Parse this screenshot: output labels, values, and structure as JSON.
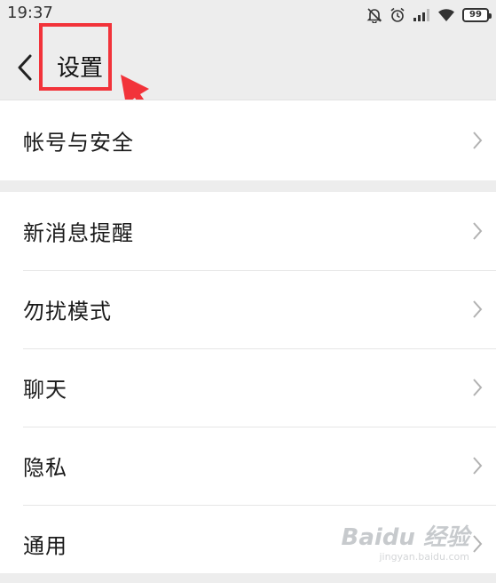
{
  "status_bar": {
    "time": "19:37",
    "battery": "99",
    "icons": [
      "mute-icon",
      "alarm-icon",
      "signal-icon",
      "wifi-icon",
      "battery-icon"
    ]
  },
  "nav": {
    "title": "设置",
    "back_icon": "chevron-left-icon"
  },
  "annotation": {
    "color": "#f2333a"
  },
  "sections": [
    {
      "items": [
        {
          "label": "帐号与安全"
        }
      ]
    },
    {
      "items": [
        {
          "label": "新消息提醒"
        },
        {
          "label": "勿扰模式"
        },
        {
          "label": "聊天"
        },
        {
          "label": "隐私"
        },
        {
          "label": "通用"
        }
      ]
    }
  ],
  "watermark": {
    "logo": "Baidu 经验",
    "sub": "jingyan.baidu.com"
  }
}
